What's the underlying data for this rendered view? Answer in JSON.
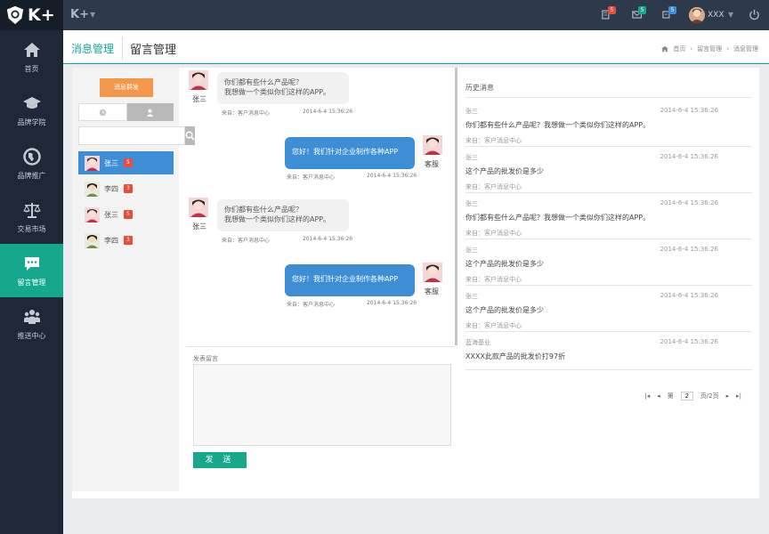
{
  "sidebar": {
    "logo_text": "K+",
    "items": [
      {
        "label": "首页",
        "icon": "home-icon"
      },
      {
        "label": "品牌学院",
        "icon": "graduation-cap-icon"
      },
      {
        "label": "品牌推广",
        "icon": "globe-icon"
      },
      {
        "label": "交易市场",
        "icon": "scale-icon"
      },
      {
        "label": "留言管理",
        "icon": "chat-icon",
        "active": true
      },
      {
        "label": "推送中心",
        "icon": "group-icon"
      }
    ]
  },
  "topbar": {
    "brand": "K+",
    "badges": [
      {
        "icon": "tasks-icon",
        "count": "5",
        "color": "#e74c3c"
      },
      {
        "icon": "mail-icon",
        "count": "5",
        "color": "#16a88d"
      },
      {
        "icon": "comments-icon",
        "count": "5",
        "color": "#3e8ed6"
      }
    ],
    "user_name": "XXX"
  },
  "header": {
    "active_tab": "消息管理",
    "title": "留言管理",
    "breadcrumb": [
      "首页",
      "留言管理",
      "消息管理"
    ]
  },
  "contacts": {
    "broadcast_label": "消息群发",
    "search_placeholder": "",
    "list": [
      {
        "name": "张三",
        "count": "5",
        "active": true
      },
      {
        "name": "李四",
        "count": "3"
      },
      {
        "name": "张三",
        "count": "5"
      },
      {
        "name": "李四",
        "count": "3"
      }
    ]
  },
  "chat": {
    "messages": [
      {
        "dir": "in",
        "name": "张三",
        "lines": [
          "你们都有些什么产品呢？",
          "我想做一个类似你们这样的APP。"
        ],
        "source": "来自：客户消息中心",
        "time": "2014-6-4 15:36:26"
      },
      {
        "dir": "out",
        "name": "客服",
        "text": "您好！我们针对企业制作各种APP",
        "source": "来自：客户消息中心",
        "time": "2014-6-4 15:36:26"
      },
      {
        "dir": "in",
        "name": "张三",
        "lines": [
          "你们都有些什么产品呢？",
          "我想做一个类似你们这样的APP。"
        ],
        "source": "来自：客户消息中心",
        "time": "2014-6-4 15:36:26"
      },
      {
        "dir": "out",
        "name": "客服",
        "text": "您好！我们针对企业制作各种APP",
        "source": "来自：客户消息中心",
        "time": "2014-6-4 15:36:26"
      }
    ]
  },
  "reply": {
    "label": "发表留言",
    "value": "",
    "send_label": "发 送"
  },
  "history": {
    "title": "历史消息",
    "items": [
      {
        "sender": "张三",
        "time": "2014-6-4 15:36:26",
        "text": "你们都有些什么产品呢？我想做一个类似你们这样的APP。",
        "source": "来自：客户消息中心"
      },
      {
        "sender": "张三",
        "time": "2014-6-4 15:36:26",
        "text": "这个产品的批发价是多少",
        "source": "来自：客户消息中心"
      },
      {
        "sender": "张三",
        "time": "2014-6-4 15:36:26",
        "text": "你们都有些什么产品呢？我想做一个类似你们这样的APP。",
        "source": "来自：客户消息中心"
      },
      {
        "sender": "张三",
        "time": "2014-6-4 15:36:26",
        "text": "这个产品的批发价是多少",
        "source": "来自：客户消息中心"
      },
      {
        "sender": "张三",
        "time": "2014-6-4 15:36:26",
        "text": "这个产品的批发价是多少",
        "source": "来自：客户消息中心"
      },
      {
        "sender": "蓝海基业",
        "time": "2014-6-4 15:36:26",
        "text": "XXXX此款产品的批发价打97折",
        "source": ""
      }
    ],
    "pager": {
      "page_prefix": "第",
      "page_value": "2",
      "page_suffix": "页/2页"
    }
  },
  "colors": {
    "accent": "#16a88d",
    "blue": "#3e8ed6",
    "orange": "#f3974a",
    "danger": "#e74c3c"
  }
}
